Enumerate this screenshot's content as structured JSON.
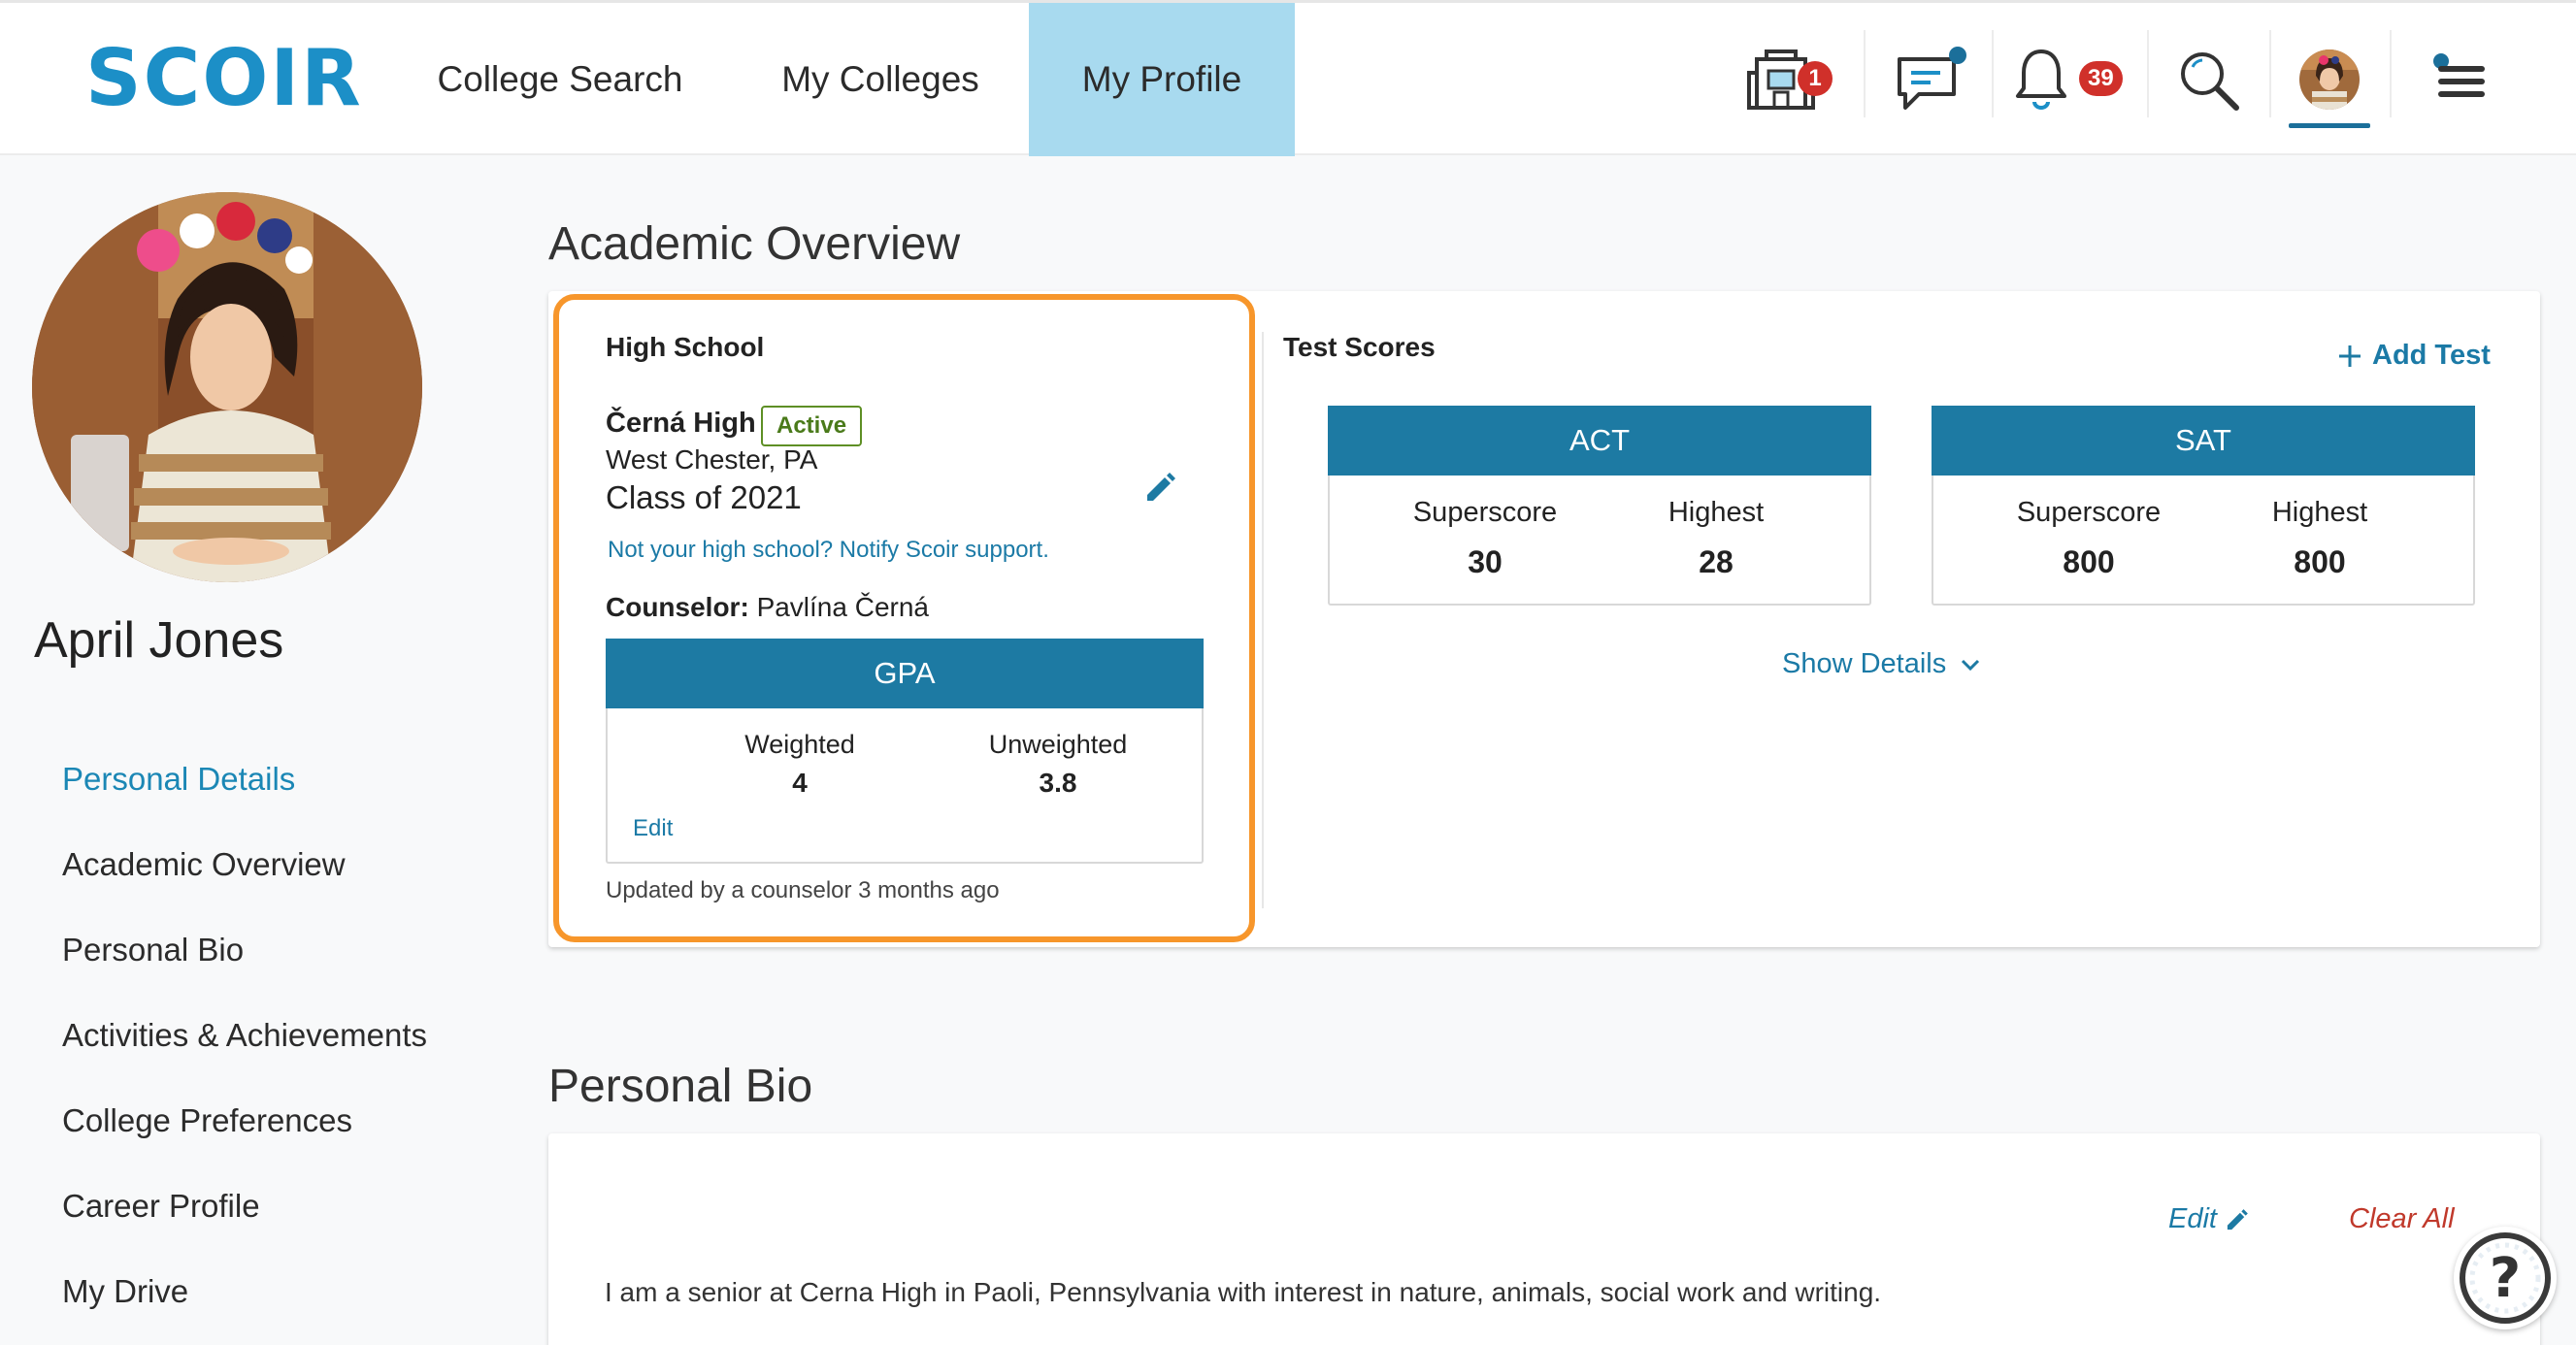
{
  "brand": {
    "logo": "SCOIR",
    "color": "#1c8fc7"
  },
  "nav": {
    "tabs": [
      {
        "label": "College Search",
        "active": false
      },
      {
        "label": "My Colleges",
        "active": false
      },
      {
        "label": "My Profile",
        "active": true
      }
    ]
  },
  "header_icons": {
    "colleges": {
      "icon": "building-icon",
      "badge": "1"
    },
    "messages": {
      "icon": "chat-icon",
      "dot": true
    },
    "notifications": {
      "icon": "bell-icon",
      "badge": "39"
    },
    "search": {
      "icon": "search-icon"
    },
    "avatar": {
      "icon": "avatar"
    },
    "menu": {
      "icon": "hamburger-icon"
    }
  },
  "sidebar": {
    "name": "April Jones",
    "items": [
      {
        "label": "Personal Details",
        "active": true
      },
      {
        "label": "Academic Overview",
        "active": false
      },
      {
        "label": "Personal Bio",
        "active": false
      },
      {
        "label": "Activities & Achievements",
        "active": false
      },
      {
        "label": "College Preferences",
        "active": false
      },
      {
        "label": "Career Profile",
        "active": false
      },
      {
        "label": "My Drive",
        "active": false
      }
    ]
  },
  "academic": {
    "title": "Academic Overview",
    "high_school": {
      "heading": "High School",
      "name": "Černá High",
      "status": "Active",
      "location": "West Chester, PA",
      "class": "Class of 2021",
      "notify": "Not your high school? Notify Scoir support.",
      "counselor_label": "Counselor:",
      "counselor_name": "Pavlína Černá",
      "gpa": {
        "title": "GPA",
        "weighted_label": "Weighted",
        "weighted_value": "4",
        "unweighted_label": "Unweighted",
        "unweighted_value": "3.8",
        "edit": "Edit"
      },
      "updated": "Updated by a counselor 3 months ago"
    },
    "test_scores": {
      "heading": "Test Scores",
      "add_test": "Add Test",
      "tests": [
        {
          "name": "ACT",
          "superscore_label": "Superscore",
          "superscore": "30",
          "highest_label": "Highest",
          "highest": "28"
        },
        {
          "name": "SAT",
          "superscore_label": "Superscore",
          "superscore": "800",
          "highest_label": "Highest",
          "highest": "800"
        }
      ],
      "show_details": "Show Details"
    }
  },
  "bio": {
    "title": "Personal Bio",
    "edit": "Edit",
    "clear_all": "Clear All",
    "text": "I am a senior at Cerna High in Paoli, Pennsylvania with interest in nature, animals, social work and writing."
  },
  "help": {
    "icon": "help-icon",
    "glyph": "?"
  },
  "colors": {
    "accent": "#1d7aa3",
    "highlight": "#f7962b",
    "active_tab": "#a8daef",
    "badge": "#d0302a",
    "danger": "#c0392b",
    "active_green": "#4a7a1a"
  }
}
